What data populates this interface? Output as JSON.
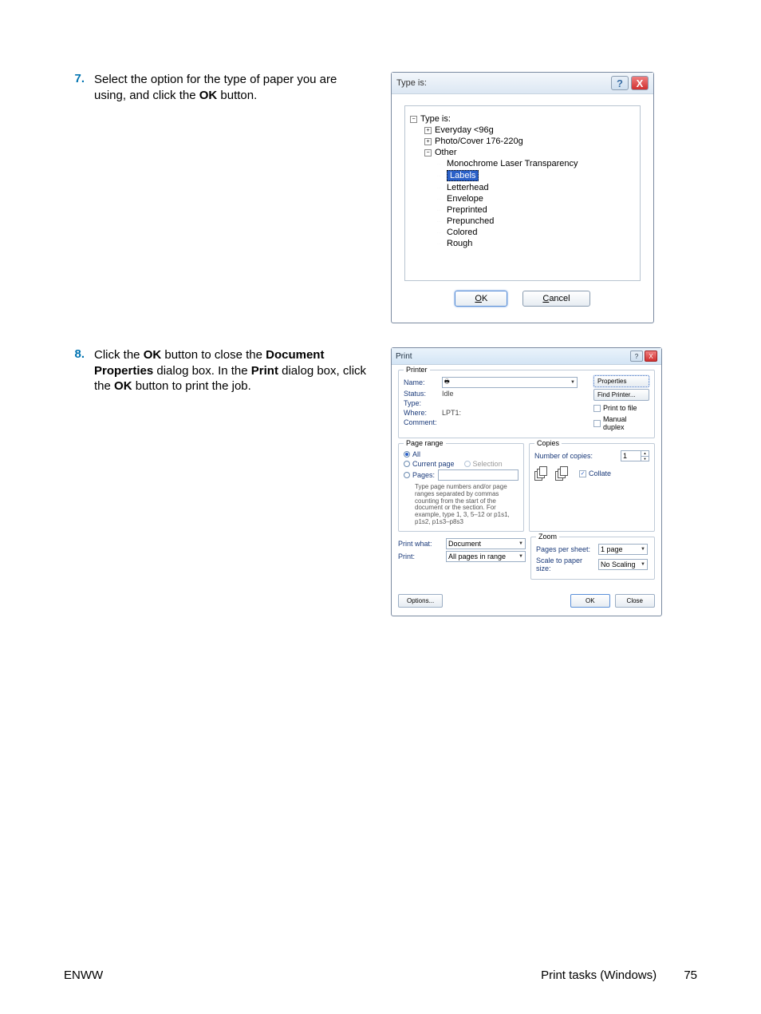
{
  "steps": {
    "s7": {
      "num": "7.",
      "text_before": "Select the option for the type of paper you are using, and click the ",
      "bold1": "OK",
      "text_after": " button."
    },
    "s8": {
      "num": "8.",
      "p1": "Click the ",
      "b1": "OK",
      "p2": " button to close the ",
      "b2": "Document Properties",
      "p3": " dialog box. In the ",
      "b3": "Print",
      "p4": " dialog box, click the ",
      "b4": "OK",
      "p5": " button to print the job."
    }
  },
  "type_dialog": {
    "title": "Type is:",
    "root": "Type is:",
    "n1": "Everyday <96g",
    "n2": "Photo/Cover 176-220g",
    "n3": "Other",
    "leaf_mono": "Monochrome Laser Transparency",
    "leaf_labels": "Labels",
    "leaf_letterhead": "Letterhead",
    "leaf_envelope": "Envelope",
    "leaf_preprinted": "Preprinted",
    "leaf_prepunched": "Prepunched",
    "leaf_colored": "Colored",
    "leaf_rough": "Rough",
    "ok": "OK",
    "cancel": "Cancel"
  },
  "print_dialog": {
    "title": "Print",
    "printer_legend": "Printer",
    "name_label": "Name:",
    "status_label": "Status:",
    "status_value": "Idle",
    "type_label": "Type:",
    "where_label": "Where:",
    "where_value": "LPT1:",
    "comment_label": "Comment:",
    "properties_btn": "Properties",
    "find_printer_btn": "Find Printer...",
    "print_to_file": "Print to file",
    "manual_duplex": "Manual duplex",
    "page_range_legend": "Page range",
    "all": "All",
    "current_page": "Current page",
    "selection": "Selection",
    "pages": "Pages:",
    "pages_help": "Type page numbers and/or page ranges separated by commas counting from the start of the document or the section. For example, type 1, 3, 5–12 or p1s1, p1s2, p1s3–p8s3",
    "copies_legend": "Copies",
    "num_copies_label": "Number of copies:",
    "num_copies_value": "1",
    "collate": "Collate",
    "print_what_label": "Print what:",
    "print_what_value": "Document",
    "print_label": "Print:",
    "print_value": "All pages in range",
    "zoom_legend": "Zoom",
    "pps_label": "Pages per sheet:",
    "pps_value": "1 page",
    "sps_label": "Scale to paper size:",
    "sps_value": "No Scaling",
    "options_btn": "Options...",
    "ok_btn": "OK",
    "close_btn": "Close"
  },
  "footer": {
    "left": "ENWW",
    "right": "Print tasks (Windows)",
    "page": "75"
  }
}
